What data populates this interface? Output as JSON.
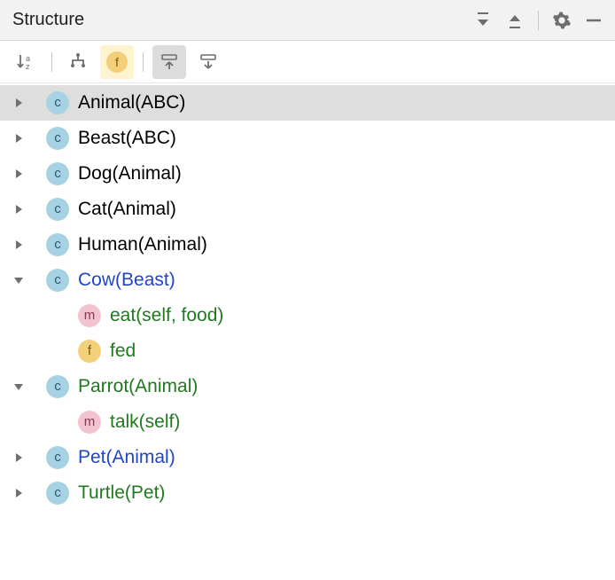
{
  "header": {
    "title": "Structure"
  },
  "toolbar": {
    "sort_alpha_pressed": false,
    "show_supertypes_pressed": false,
    "show_fields_pressed": true,
    "show_inherited_pressed": true,
    "show_something_pressed": false
  },
  "tree": [
    {
      "kind": "c",
      "name": "Animal",
      "paren": "ABC",
      "color": "c-default",
      "expanded": false,
      "selected": true,
      "depth": 0
    },
    {
      "kind": "c",
      "name": "Beast",
      "paren": "ABC",
      "color": "c-default",
      "expanded": false,
      "selected": false,
      "depth": 0
    },
    {
      "kind": "c",
      "name": "Dog",
      "paren": "Animal",
      "color": "c-default",
      "expanded": false,
      "selected": false,
      "depth": 0
    },
    {
      "kind": "c",
      "name": "Cat",
      "paren": "Animal",
      "color": "c-default",
      "expanded": false,
      "selected": false,
      "depth": 0
    },
    {
      "kind": "c",
      "name": "Human",
      "paren": "Animal",
      "color": "c-default",
      "expanded": false,
      "selected": false,
      "depth": 0
    },
    {
      "kind": "c",
      "name": "Cow",
      "paren": "Beast",
      "color": "c-blue",
      "expanded": true,
      "selected": false,
      "depth": 0
    },
    {
      "kind": "m",
      "name": "eat",
      "paren": "self, food",
      "color": "c-green",
      "expanded": null,
      "selected": false,
      "depth": 1
    },
    {
      "kind": "f",
      "name": "fed",
      "paren": null,
      "color": "c-green",
      "expanded": null,
      "selected": false,
      "depth": 1
    },
    {
      "kind": "c",
      "name": "Parrot",
      "paren": "Animal",
      "color": "c-green",
      "expanded": true,
      "selected": false,
      "depth": 0
    },
    {
      "kind": "m",
      "name": "talk",
      "paren": "self",
      "color": "c-green",
      "expanded": null,
      "selected": false,
      "depth": 1
    },
    {
      "kind": "c",
      "name": "Pet",
      "paren": "Animal",
      "color": "c-blue",
      "expanded": false,
      "selected": false,
      "depth": 0
    },
    {
      "kind": "c",
      "name": "Turtle",
      "paren": "Pet",
      "color": "c-green",
      "expanded": false,
      "selected": false,
      "depth": 0
    }
  ],
  "badge_letters": {
    "c": "c",
    "m": "m",
    "f": "f"
  }
}
